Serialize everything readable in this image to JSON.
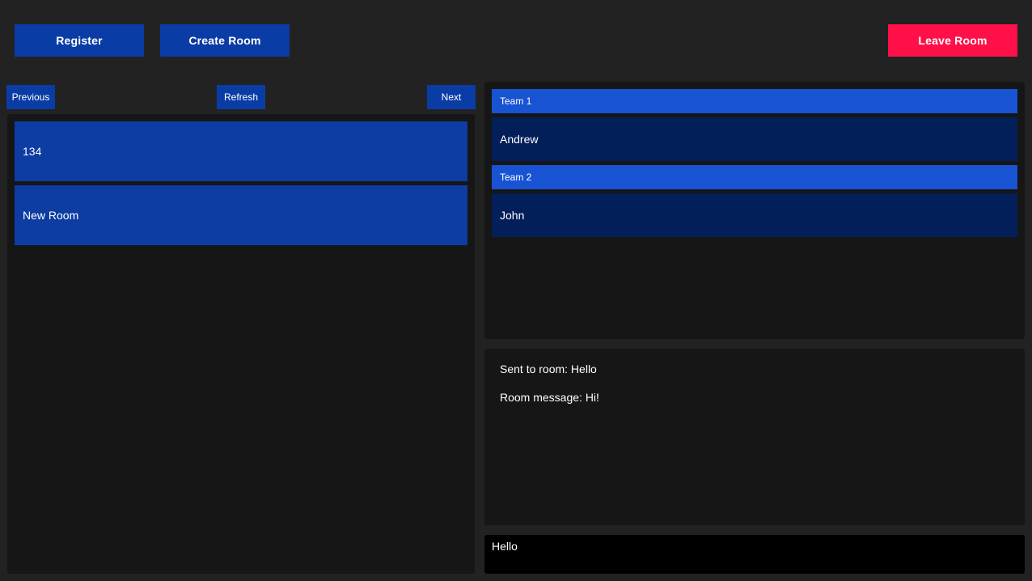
{
  "toolbar": {
    "register_label": "Register",
    "create_room_label": "Create Room",
    "leave_room_label": "Leave Room"
  },
  "pager": {
    "previous_label": "Previous",
    "refresh_label": "Refresh",
    "next_label": "Next"
  },
  "rooms": [
    {
      "name": "134"
    },
    {
      "name": "New Room"
    }
  ],
  "teams": [
    {
      "name": "Team 1",
      "members": [
        "Andrew"
      ]
    },
    {
      "name": "Team 2",
      "members": [
        "John"
      ]
    }
  ],
  "messages": [
    "Sent to room: Hello",
    "Room message: Hi!"
  ],
  "chat": {
    "value": "Hello"
  },
  "colors": {
    "primary_button": "#0a3ca6",
    "danger_button": "#ff1048",
    "team_header": "#1753d2",
    "team_member": "#031f59",
    "panel": "#161616",
    "background": "#222222"
  }
}
